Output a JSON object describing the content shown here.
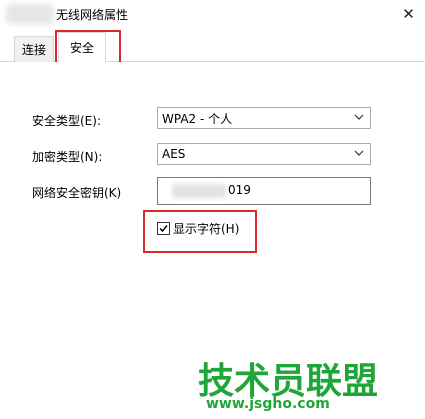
{
  "window": {
    "title": "无线网络属性",
    "close_label": "✕"
  },
  "tabs": [
    {
      "label": "连接",
      "selected": false
    },
    {
      "label": "安全",
      "selected": true
    }
  ],
  "form": {
    "security_type": {
      "label": "安全类型(E):",
      "value": "WPA2 - 个人"
    },
    "encryption_type": {
      "label": "加密类型(N):",
      "value": "AES"
    },
    "network_key": {
      "label": "网络安全密钥(K)",
      "value": "019"
    },
    "show_chars": {
      "label": "显示字符(H)",
      "checked": true
    }
  },
  "watermark": {
    "name": "技术员联盟",
    "url": "www.jsgho.com"
  },
  "colors": {
    "highlight": "#d92a2a",
    "watermark": "#1fa638"
  }
}
